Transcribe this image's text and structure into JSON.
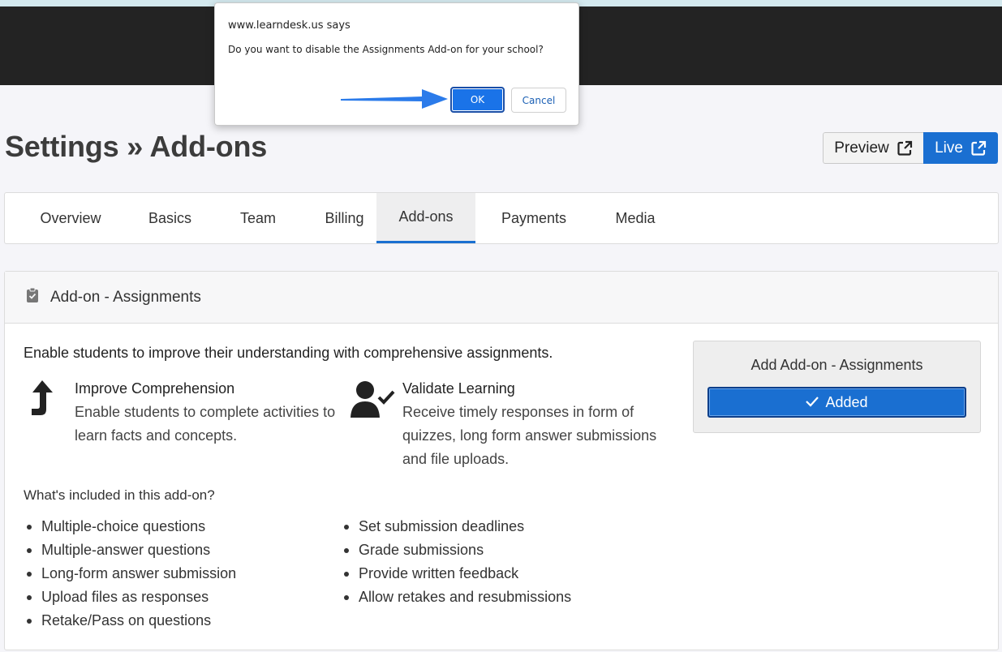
{
  "dialog": {
    "origin": "www.learndesk.us says",
    "message": "Do you want to disable the Assignments Add-on for your school?",
    "ok_label": "OK",
    "cancel_label": "Cancel"
  },
  "header": {
    "title": "Settings » Add-ons",
    "preview_label": "Preview",
    "live_label": "Live"
  },
  "tabs": [
    {
      "label": "Overview"
    },
    {
      "label": "Basics"
    },
    {
      "label": "Team"
    },
    {
      "label": "Billing"
    },
    {
      "label": "Add-ons",
      "active": true
    },
    {
      "label": "Payments"
    },
    {
      "label": "Media"
    }
  ],
  "panel": {
    "title": "Add-on - Assignments",
    "intro": "Enable students to improve their understanding with comprehensive assignments.",
    "features": [
      {
        "icon": "arrow-turn-up-icon",
        "title": "Improve Comprehension",
        "lines": [
          "Enable students to complete activities to",
          "learn facts and concepts."
        ]
      },
      {
        "icon": "user-check-icon",
        "title": "Validate Learning",
        "lines": [
          "Receive timely responses in form of",
          "quizzes, long form answer submissions",
          "and file uploads."
        ]
      }
    ],
    "included_heading": "What's included in this add-on?",
    "included_left": [
      "Multiple-choice questions",
      "Multiple-answer questions",
      "Long-form answer submission",
      "Upload files as responses",
      "Retake/Pass on questions"
    ],
    "included_right": [
      "Set submission deadlines",
      "Grade submissions",
      "Provide written feedback",
      "Allow retakes and resubmissions"
    ]
  },
  "addbox": {
    "title": "Add Add-on - Assignments",
    "button_label": "Added"
  },
  "colors": {
    "accent": "#1a6fd1",
    "topbar": "#232323"
  }
}
